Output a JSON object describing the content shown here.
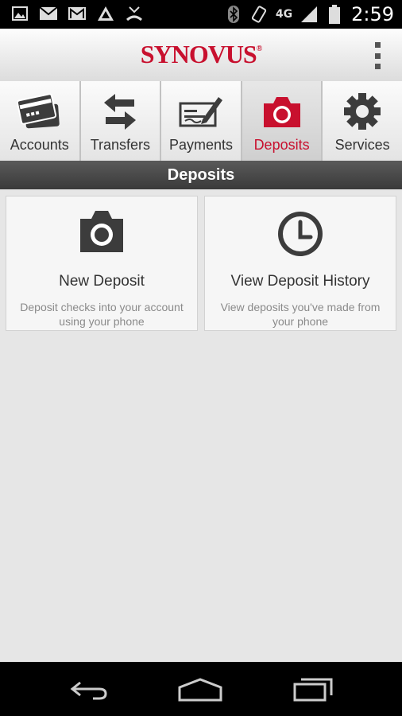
{
  "status_bar": {
    "left_icons": [
      "image-icon",
      "mail-icon",
      "gmail-icon",
      "app-icon",
      "missed-call-icon"
    ],
    "network": "4G",
    "time": "2:59"
  },
  "app": {
    "brand": "SYNOVUS",
    "brand_mark": "®",
    "brand_color": "#c8102e"
  },
  "tabs": [
    {
      "label": "Accounts",
      "icon": "credit-card-icon",
      "active": false
    },
    {
      "label": "Transfers",
      "icon": "transfer-arrows-icon",
      "active": false
    },
    {
      "label": "Payments",
      "icon": "check-pen-icon",
      "active": false
    },
    {
      "label": "Deposits",
      "icon": "camera-icon",
      "active": true
    },
    {
      "label": "Services",
      "icon": "gear-icon",
      "active": false
    }
  ],
  "section": {
    "title": "Deposits"
  },
  "cards": [
    {
      "title": "New Deposit",
      "subtitle": "Deposit checks into your account using your phone",
      "icon": "camera-icon"
    },
    {
      "title": "View Deposit History",
      "subtitle": "View deposits you've made from your phone",
      "icon": "clock-icon"
    }
  ],
  "navigation": [
    "back-icon",
    "home-icon",
    "recent-apps-icon"
  ]
}
